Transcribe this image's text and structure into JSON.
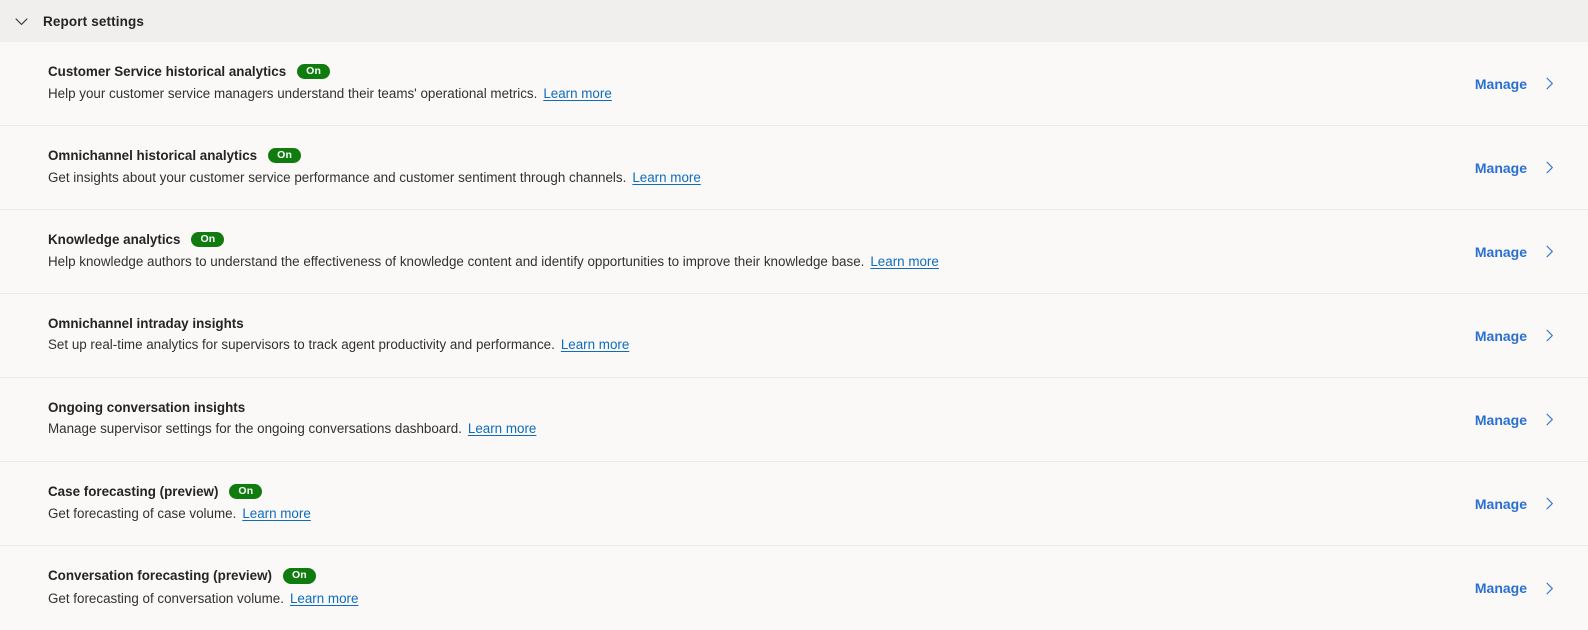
{
  "section": {
    "title": "Report settings",
    "expanded": true,
    "collapse_icon": "chevron-down-icon"
  },
  "colors": {
    "header_background": "#f0efee",
    "page_background": "#faf9f8",
    "divider": "#edebe9",
    "badge_on": "#107c10",
    "link": "#0f6cbd",
    "manage_link": "#2b6fcf",
    "title_text": "#242424",
    "body_text": "#323130"
  },
  "common": {
    "manage_label": "Manage",
    "manage_icon": "chevron-right-icon",
    "learn_more_label": "Learn more"
  },
  "settings": [
    {
      "title": "Customer Service historical analytics",
      "badge": "On",
      "description": "Help your customer service managers understand their teams' operational metrics.",
      "learn_more": "Learn more",
      "action": "Manage"
    },
    {
      "title": "Omnichannel historical analytics",
      "badge": "On",
      "description": "Get insights about your customer service performance and customer sentiment through channels.",
      "learn_more": "Learn more",
      "action": "Manage"
    },
    {
      "title": "Knowledge analytics",
      "badge": "On",
      "description": "Help knowledge authors to understand the effectiveness of knowledge content and identify opportunities to improve their knowledge base.",
      "learn_more": "Learn more",
      "action": "Manage"
    },
    {
      "title": "Omnichannel intraday insights",
      "badge": "",
      "description": "Set up real-time analytics for supervisors to track agent productivity and performance.",
      "learn_more": "Learn more",
      "action": "Manage"
    },
    {
      "title": "Ongoing conversation insights",
      "badge": "",
      "description": "Manage supervisor settings for the ongoing conversations dashboard.",
      "learn_more": "Learn more",
      "action": "Manage"
    },
    {
      "title": "Case forecasting (preview)",
      "badge": "On",
      "description": "Get forecasting of case volume.",
      "learn_more": "Learn more",
      "action": "Manage"
    },
    {
      "title": "Conversation forecasting (preview)",
      "badge": "On",
      "description": "Get forecasting of conversation volume.",
      "learn_more": "Learn more",
      "action": "Manage"
    }
  ]
}
